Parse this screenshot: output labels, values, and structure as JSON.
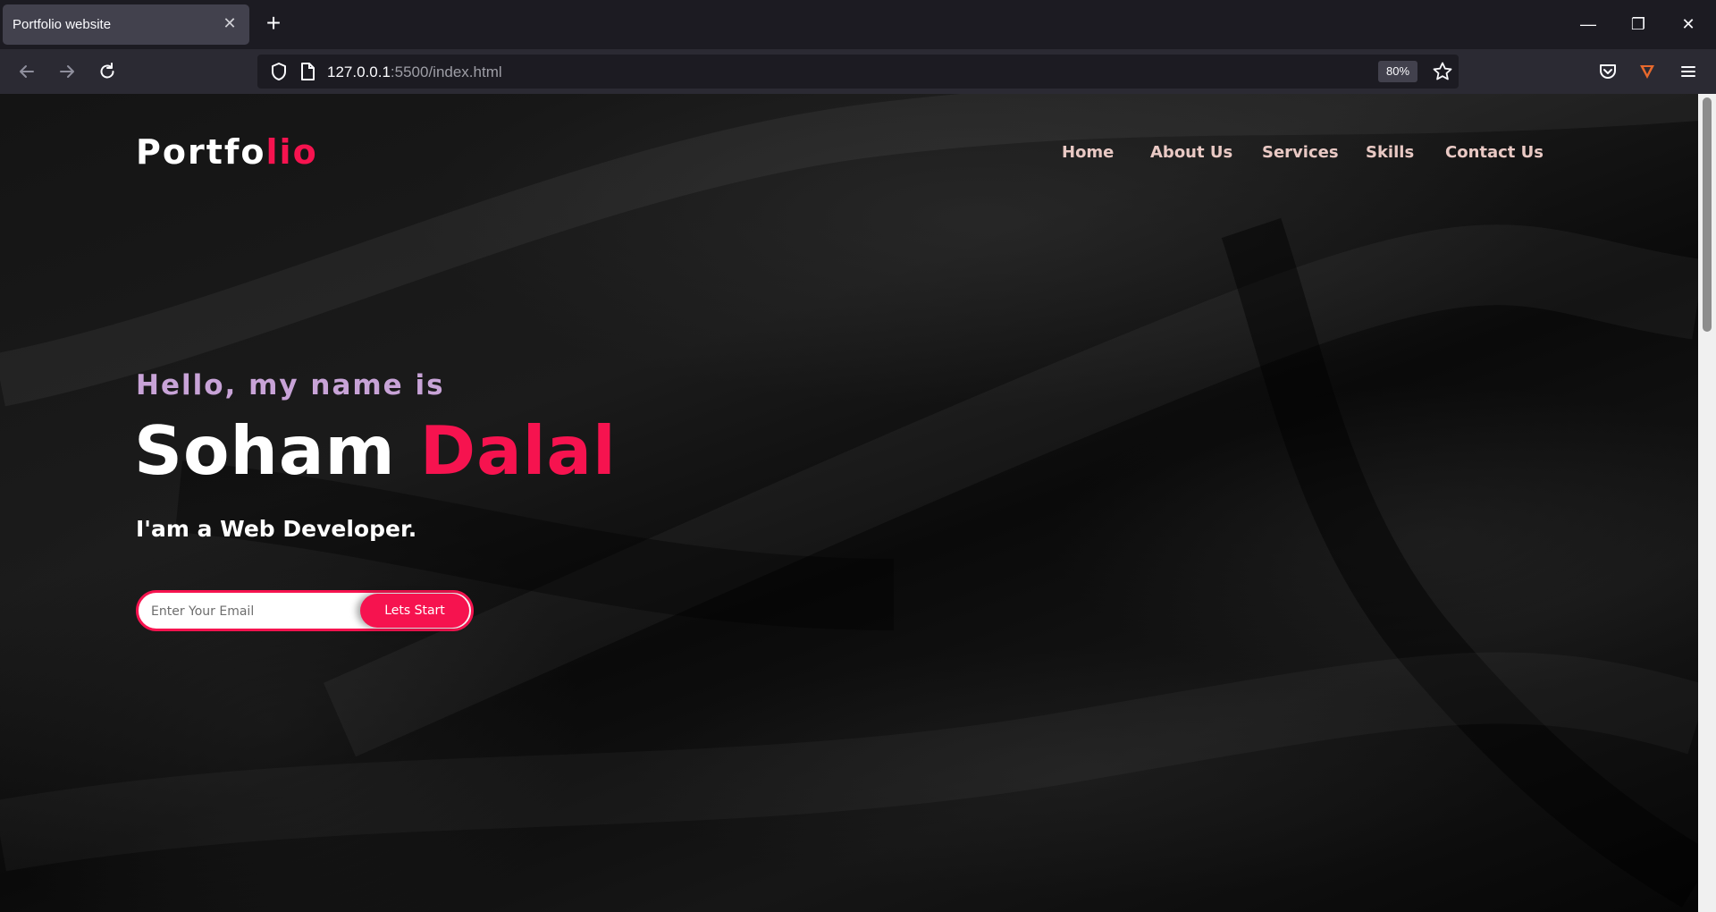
{
  "browser": {
    "tab_title": "Portfolio website",
    "tab_close": "✕",
    "new_tab": "+",
    "url_host": "127.0.0.1",
    "url_rest": ":5500/index.html",
    "zoom": "80%",
    "window_controls": {
      "minimize": "—",
      "restore": "❐",
      "close": "✕"
    }
  },
  "site": {
    "logo_main": "Portfo",
    "logo_accent": "lio",
    "menu": [
      "Home",
      "About Us",
      "Services",
      "Skills",
      "Contact Us"
    ],
    "greeting": "Hello, my name is",
    "first_name": "Soham",
    "last_name": "Dalal",
    "role": "I'am a Web Developer.",
    "email_placeholder": "Enter Your Email",
    "cta_label": "Lets Start"
  },
  "colors": {
    "accent": "#f6134f",
    "menu_text": "#e9c9c4",
    "greeting_text": "#c8a3d7"
  }
}
